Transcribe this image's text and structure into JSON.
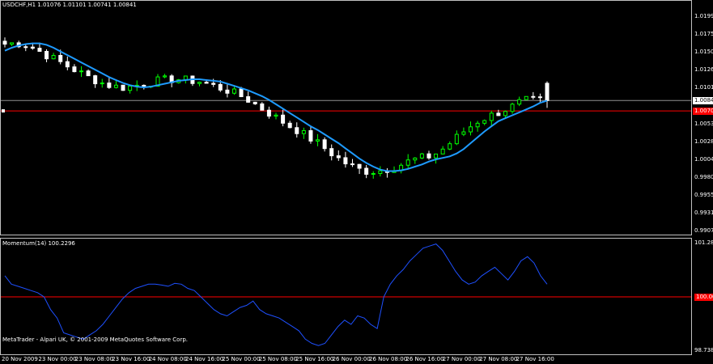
{
  "chart_window": {
    "header": "USDCHF,H1  1.01076 1.01101 1.00741 1.00841",
    "copyright": "MetaTrader - Alpari UK, © 2001-2009 MetaQuotes Software Corp."
  },
  "colors": {
    "background": "#000000",
    "frame": "#c0c0c0",
    "bull_candle": "#00ff00",
    "bear_candle": "#ffffff",
    "moving_average": "#1e9bff",
    "momentum_line": "#1e50ff",
    "level_line": "#ff0000",
    "bid_line": "#909090"
  },
  "chart_data": [
    {
      "type": "candlestick",
      "symbol": "USDCHF",
      "timeframe": "H1",
      "last": {
        "open": 1.01076,
        "high": 1.01101,
        "low": 1.00741,
        "close": 1.00841
      },
      "y_ticks": [
        "1.01990",
        "1.01750",
        "1.01505",
        "1.01260",
        "1.01015",
        "1.00841",
        "1.00530",
        "1.00285",
        "1.00045",
        "0.99800",
        "0.99555",
        "0.99315",
        "0.99070"
      ],
      "ylim": [
        0.9907,
        1.0199
      ],
      "current_price_label": "1.00841",
      "level_label": "1.00700",
      "level_price": 1.007,
      "moving_average": [
        1.0152,
        1.0156,
        1.0159,
        1.0161,
        1.0162,
        1.0162,
        1.016,
        1.0156,
        1.0151,
        1.0146,
        1.0141,
        1.0136,
        1.0131,
        1.0126,
        1.0121,
        1.0116,
        1.0112,
        1.0108,
        1.0105,
        1.0103,
        1.0102,
        1.0103,
        1.0105,
        1.0107,
        1.0109,
        1.0111,
        1.0112,
        1.0113,
        1.0113,
        1.0112,
        1.0111,
        1.011,
        1.0107,
        1.0104,
        1.0101,
        1.0098,
        1.0094,
        1.009,
        1.0085,
        1.0079,
        1.0073,
        1.0067,
        1.0061,
        1.0055,
        1.0049,
        1.0044,
        1.0038,
        1.0032,
        1.0026,
        1.0019,
        1.0012,
        1.0005,
        0.9999,
        0.9994,
        0.999,
        0.9988,
        0.9988,
        0.9989,
        0.9991,
        0.9994,
        0.9997,
        1.0001,
        1.0004,
        1.0006,
        1.0008,
        1.0012,
        1.0018,
        1.0026,
        1.0034,
        1.0042,
        1.0049,
        1.0056,
        1.006,
        1.0064,
        1.0068,
        1.0072,
        1.0076,
        1.0081,
        1.0084
      ],
      "x_ticks": [
        "20 Nov 2009",
        "23 Nov 00:00",
        "23 Nov 08:00",
        "23 Nov 16:00",
        "24 Nov 08:00",
        "24 Nov 16:00",
        "25 Nov 00:00",
        "25 Nov 08:00",
        "25 Nov 16:00",
        "26 Nov 00:00",
        "26 Nov 08:00",
        "26 Nov 16:00",
        "27 Nov 00:00",
        "27 Nov 08:00",
        "27 Nov 16:00"
      ]
    },
    {
      "type": "line",
      "title": "Momentum(14) 100.2296",
      "indicator": "Momentum(14)",
      "last_value": 100.2296,
      "y_ticks": [
        "101.281",
        "100.000",
        "98.7384"
      ],
      "ylim": [
        98.7384,
        101.281
      ],
      "level": 100.0,
      "values": [
        100.5,
        100.3,
        100.25,
        100.2,
        100.15,
        100.1,
        100.0,
        99.7,
        99.5,
        99.15,
        99.1,
        99.05,
        99.0,
        99.1,
        99.2,
        99.35,
        99.55,
        99.75,
        99.95,
        100.1,
        100.2,
        100.25,
        100.3,
        100.3,
        100.28,
        100.25,
        100.32,
        100.3,
        100.2,
        100.15,
        100.0,
        99.85,
        99.7,
        99.6,
        99.55,
        99.65,
        99.75,
        99.8,
        99.9,
        99.7,
        99.6,
        99.55,
        99.5,
        99.4,
        99.3,
        99.2,
        99.0,
        98.9,
        98.85,
        98.9,
        99.1,
        99.3,
        99.45,
        99.35,
        99.55,
        99.5,
        99.35,
        99.25,
        100.0,
        100.3,
        100.5,
        100.65,
        100.85,
        101.0,
        101.15,
        101.2,
        101.25,
        101.1,
        100.85,
        100.6,
        100.4,
        100.3,
        100.35,
        100.5,
        100.6,
        100.7,
        100.55,
        100.4,
        100.6,
        100.85,
        100.95,
        100.8,
        100.5,
        100.3
      ]
    }
  ]
}
